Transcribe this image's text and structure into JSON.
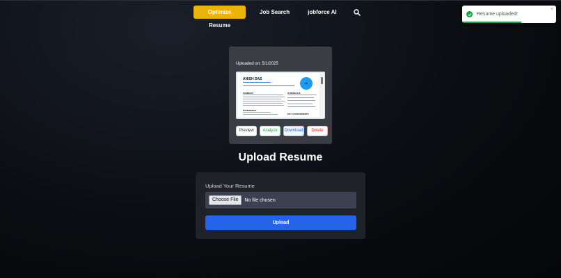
{
  "nav": {
    "optimize_label": "Optimize Resume",
    "job_search_label": "Job Search",
    "jobforce_ai_label": "jobforce AI",
    "search_icon": "search-icon"
  },
  "toast": {
    "message": "Resume uploaded!",
    "close_glyph": "×",
    "icon": "check-circle-icon",
    "progress": 0.63
  },
  "resume_card": {
    "uploaded_on": "Uploaded on: 5/1/2025",
    "preview": {
      "name": "ANISH DAS",
      "avatar_initials": "AD",
      "sections": [
        "SUMMARY",
        "STRENGTHS",
        "EXPERIENCE",
        "KEY ACHIEVEMENTS"
      ]
    },
    "actions": {
      "preview": "Preview",
      "analyze": "Analyze",
      "download": "Download",
      "delete": "Delete"
    }
  },
  "heading": "Upload Resume",
  "upload": {
    "label": "Upload Your Resume",
    "choose_file": "Choose File",
    "file_status": "No file chosen",
    "submit": "Upload"
  },
  "colors": {
    "accent_yellow": "#eab308",
    "primary_blue": "#2563eb",
    "success_green": "#16a34a",
    "danger_red": "#dc2626"
  }
}
